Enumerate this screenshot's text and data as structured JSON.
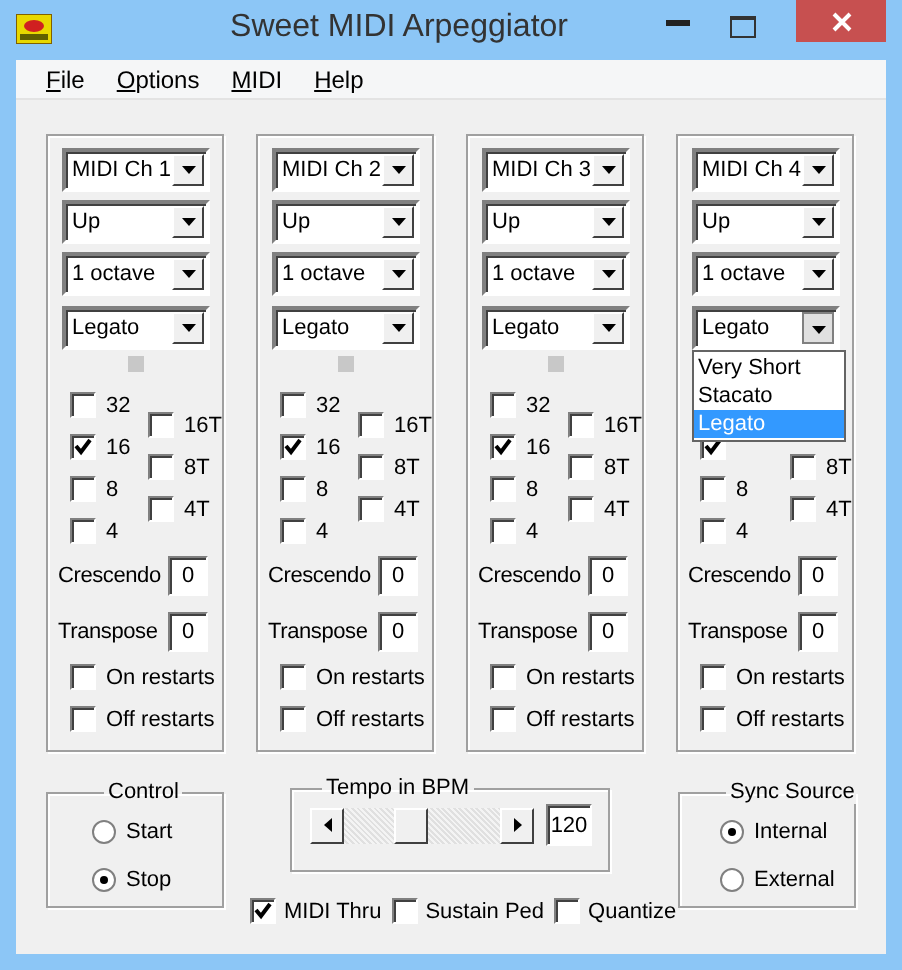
{
  "window": {
    "title": "Sweet MIDI Arpeggiator"
  },
  "menu": [
    "File",
    "Options",
    "MIDI",
    "Help"
  ],
  "channels": [
    {
      "channel": "MIDI Ch 1",
      "direction": "Up",
      "range": "1 octave",
      "articulation": {
        "value": "Legato",
        "expanded": false
      },
      "notes": {
        "left": [
          {
            "label": "32",
            "checked": false
          },
          {
            "label": "16",
            "checked": true
          },
          {
            "label": "8",
            "checked": false
          },
          {
            "label": "4",
            "checked": false
          }
        ],
        "right": [
          {
            "label": "16T",
            "checked": false
          },
          {
            "label": "8T",
            "checked": false
          },
          {
            "label": "4T",
            "checked": false
          }
        ]
      },
      "crescendo": {
        "label": "Crescendo",
        "value": "0"
      },
      "transpose": {
        "label": "Transpose",
        "value": "0"
      },
      "restarts": [
        {
          "label": "On restarts",
          "checked": false
        },
        {
          "label": "Off restarts",
          "checked": false
        }
      ]
    },
    {
      "channel": "MIDI Ch 2",
      "direction": "Up",
      "range": "1 octave",
      "articulation": {
        "value": "Legato",
        "expanded": false
      },
      "notes": {
        "left": [
          {
            "label": "32",
            "checked": false
          },
          {
            "label": "16",
            "checked": true
          },
          {
            "label": "8",
            "checked": false
          },
          {
            "label": "4",
            "checked": false
          }
        ],
        "right": [
          {
            "label": "16T",
            "checked": false
          },
          {
            "label": "8T",
            "checked": false
          },
          {
            "label": "4T",
            "checked": false
          }
        ]
      },
      "crescendo": {
        "label": "Crescendo",
        "value": "0"
      },
      "transpose": {
        "label": "Transpose",
        "value": "0"
      },
      "restarts": [
        {
          "label": "On restarts",
          "checked": false
        },
        {
          "label": "Off restarts",
          "checked": false
        }
      ]
    },
    {
      "channel": "MIDI Ch 3",
      "direction": "Up",
      "range": "1 octave",
      "articulation": {
        "value": "Legato",
        "expanded": false
      },
      "notes": {
        "left": [
          {
            "label": "32",
            "checked": false
          },
          {
            "label": "16",
            "checked": true
          },
          {
            "label": "8",
            "checked": false
          },
          {
            "label": "4",
            "checked": false
          }
        ],
        "right": [
          {
            "label": "16T",
            "checked": false
          },
          {
            "label": "8T",
            "checked": false
          },
          {
            "label": "4T",
            "checked": false
          }
        ]
      },
      "crescendo": {
        "label": "Crescendo",
        "value": "0"
      },
      "transpose": {
        "label": "Transpose",
        "value": "0"
      },
      "restarts": [
        {
          "label": "On restarts",
          "checked": false
        },
        {
          "label": "Off restarts",
          "checked": false
        }
      ]
    },
    {
      "channel": "MIDI Ch 4",
      "direction": "Up",
      "range": "1 octave",
      "articulation": {
        "value": "Legato",
        "expanded": true,
        "options": [
          {
            "label": "Very Short",
            "selected": false
          },
          {
            "label": "Stacato",
            "selected": false
          },
          {
            "label": "Legato",
            "selected": true
          }
        ]
      },
      "notes": {
        "left": [
          {
            "checked": true
          },
          {
            "label": "8",
            "checked": false
          },
          {
            "label": "4",
            "checked": false
          }
        ],
        "right": [
          {
            "label": "8T",
            "checked": false
          },
          {
            "label": "4T",
            "checked": false
          }
        ]
      },
      "crescendo": {
        "label": "Crescendo",
        "value": "0"
      },
      "transpose": {
        "label": "Transpose",
        "value": "0"
      },
      "restarts": [
        {
          "label": "On restarts",
          "checked": false
        },
        {
          "label": "Off restarts",
          "checked": false
        }
      ]
    }
  ],
  "control": {
    "title": "Control",
    "options": [
      {
        "label": "Start",
        "selected": false
      },
      {
        "label": "Stop",
        "selected": true
      }
    ]
  },
  "tempo": {
    "title": "Tempo in BPM",
    "level": 0.41,
    "value": "120"
  },
  "toggles": [
    {
      "label": "MIDI Thru",
      "checked": true
    },
    {
      "label": "Sustain Ped",
      "checked": false
    },
    {
      "label": "Quantize",
      "checked": false
    }
  ],
  "sync": {
    "title": "Sync Source",
    "options": [
      {
        "label": "Internal",
        "selected": true
      },
      {
        "label": "External",
        "selected": false
      }
    ]
  }
}
